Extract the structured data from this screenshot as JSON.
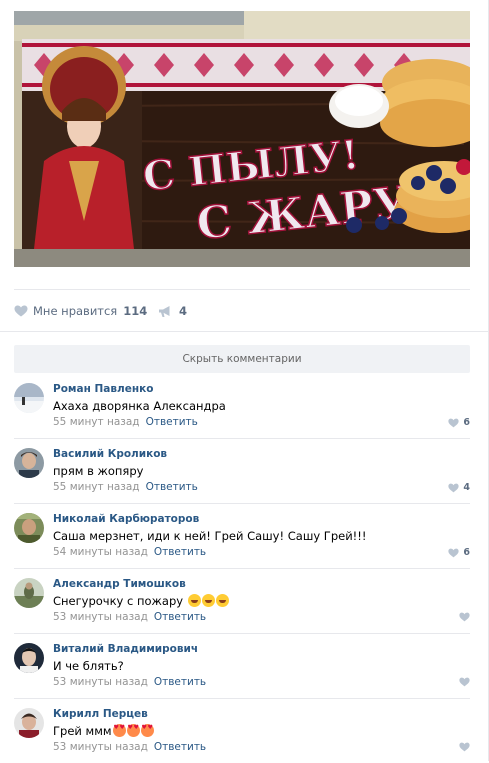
{
  "post": {
    "image_caption_line1": "С ПЫЛУ!",
    "image_caption_line2": "С ЖАРУ!"
  },
  "actions": {
    "like_label": "Мне нравится",
    "like_count": "114",
    "share_count": "4"
  },
  "comments_toggle": "Скрыть комментарии",
  "comments": [
    {
      "author": "Роман Павленко",
      "text": "Ахаха дворянка Александра",
      "time": "55 минут назад",
      "reply": "Ответить",
      "likes": "6"
    },
    {
      "author": "Василий Кроликов",
      "text": "прям в жопяру",
      "time": "55 минут назад",
      "reply": "Ответить",
      "likes": "4"
    },
    {
      "author": "Николай Карбюраторов",
      "text": "Саша мерзнет, иди к ней! Грей Сашу! Сашу Грей!!!",
      "time": "54 минуты назад",
      "reply": "Ответить",
      "likes": "6"
    },
    {
      "author": "Александр Тимошков",
      "text": "Снегурочку с пожару",
      "time": "53 минуты назад",
      "reply": "Ответить",
      "likes": ""
    },
    {
      "author": "Виталий Владимирович",
      "text": "И че блять?",
      "time": "53 минуты назад",
      "reply": "Ответить",
      "likes": ""
    },
    {
      "author": "Кирилл Перцев",
      "text": "Грей ммм",
      "time": "53 минуты назад",
      "reply": "Ответить",
      "likes": ""
    }
  ],
  "colors": {
    "link": "#2a5885",
    "muted": "#939393",
    "divider": "#e7e8ec",
    "button_bg": "#f0f2f5"
  },
  "icons": {
    "like": "heart-icon",
    "share": "megaphone-icon"
  }
}
